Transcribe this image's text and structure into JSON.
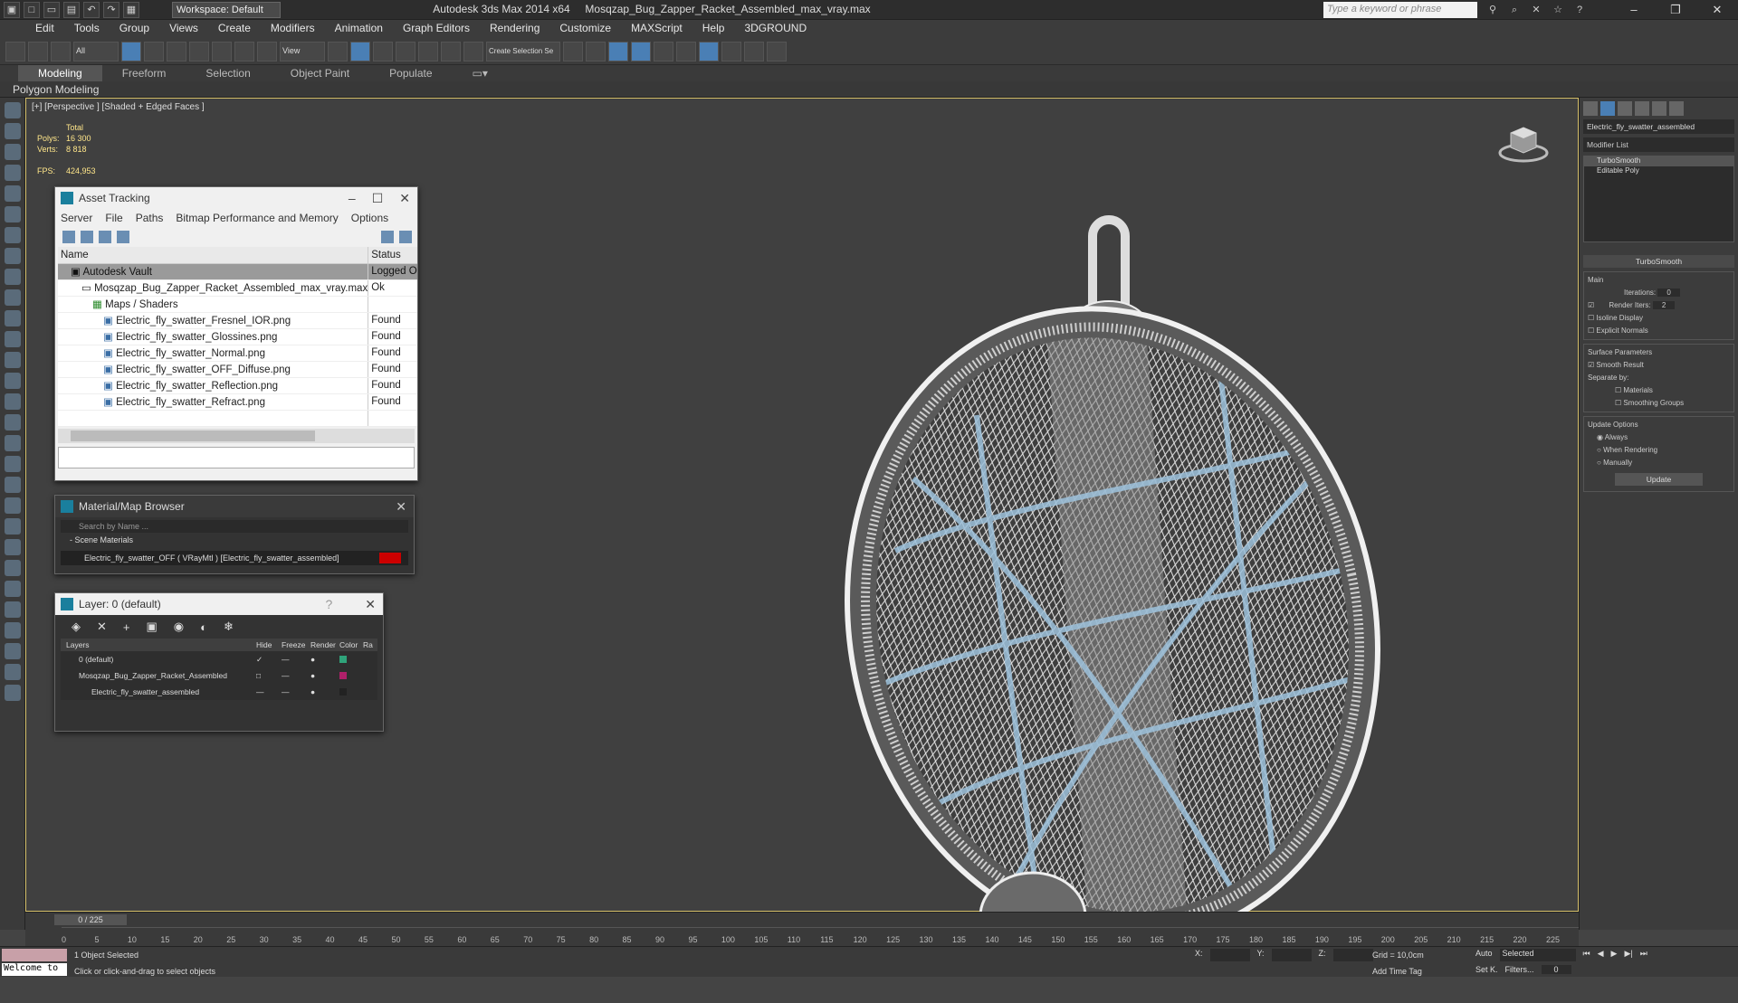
{
  "title_bar": {
    "workspace": "Workspace: Default",
    "app": "Autodesk 3ds Max  2014 x64",
    "file": "Mosqzap_Bug_Zapper_Racket_Assembled_max_vray.max",
    "search_placeholder": "Type a keyword or phrase"
  },
  "menu": [
    "Edit",
    "Tools",
    "Group",
    "Views",
    "Create",
    "Modifiers",
    "Animation",
    "Graph Editors",
    "Rendering",
    "Customize",
    "MAXScript",
    "Help",
    "3DGROUND"
  ],
  "main_toolbar": {
    "selection_filter": "All",
    "ref_coord": "View",
    "named_selection": "Create Selection Se"
  },
  "ribbon": {
    "tabs": [
      "Modeling",
      "Freeform",
      "Selection",
      "Object Paint",
      "Populate"
    ],
    "active": "Modeling",
    "sub": "Polygon Modeling"
  },
  "viewport": {
    "label": "[+] [Perspective ] [Shaded + Edged Faces ]",
    "stats_header": "Total",
    "polys_label": "Polys:",
    "polys": "16 300",
    "verts_label": "Verts:",
    "verts": "8 818",
    "fps_label": "FPS:",
    "fps": "424,953"
  },
  "asset_tracking": {
    "title": "Asset Tracking",
    "menu": [
      "Server",
      "File",
      "Paths",
      "Bitmap Performance and Memory",
      "Options"
    ],
    "col_name": "Name",
    "col_status": "Status",
    "rows": [
      {
        "name": "Autodesk Vault",
        "status": "Logged O",
        "indent": 1
      },
      {
        "name": "Mosqzap_Bug_Zapper_Racket_Assembled_max_vray.max",
        "status": "Ok",
        "indent": 2
      },
      {
        "name": "Maps / Shaders",
        "status": "",
        "indent": 3
      },
      {
        "name": "Electric_fly_swatter_Fresnel_IOR.png",
        "status": "Found",
        "indent": 4
      },
      {
        "name": "Electric_fly_swatter_Glossines.png",
        "status": "Found",
        "indent": 4
      },
      {
        "name": "Electric_fly_swatter_Normal.png",
        "status": "Found",
        "indent": 4
      },
      {
        "name": "Electric_fly_swatter_OFF_Diffuse.png",
        "status": "Found",
        "indent": 4
      },
      {
        "name": "Electric_fly_swatter_Reflection.png",
        "status": "Found",
        "indent": 4
      },
      {
        "name": "Electric_fly_swatter_Refract.png",
        "status": "Found",
        "indent": 4
      }
    ]
  },
  "material_browser": {
    "title": "Material/Map Browser",
    "search_placeholder": "Search by Name ...",
    "section": "- Scene Materials",
    "item": "Electric_fly_swatter_OFF ( VRayMtl ) [Electric_fly_swatter_assembled]"
  },
  "layer_dialog": {
    "title": "Layer: 0 (default)",
    "help": "?",
    "cols": [
      "Layers",
      "Hide",
      "Freeze",
      "Render",
      "Color",
      "Ra"
    ],
    "rows": [
      {
        "name": "0 (default)",
        "color": "#2fa37a"
      },
      {
        "name": "Mosqzap_Bug_Zapper_Racket_Assembled",
        "color": "#b0206a"
      },
      {
        "name": "Electric_fly_swatter_assembled",
        "color": "#222222"
      }
    ]
  },
  "command_panel": {
    "object_name": "Electric_fly_swatter_assembled",
    "modifier_list": "Modifier List",
    "stack": [
      "TurboSmooth",
      "Editable Poly"
    ],
    "rollout": "TurboSmooth",
    "main": "Main",
    "iterations_label": "Iterations:",
    "iterations": "0",
    "render_iters_label": "Render Iters:",
    "render_iters": "2",
    "isoline": "Isoline Display",
    "explicit": "Explicit Normals",
    "surface": "Surface Parameters",
    "smooth_result": "Smooth Result",
    "separate_by": "Separate by:",
    "materials": "Materials",
    "smoothing_groups": "Smoothing Groups",
    "update_options": "Update Options",
    "always": "Always",
    "when_rendering": "When Rendering",
    "manually": "Manually",
    "update_button": "Update"
  },
  "timeline": {
    "slider": "0 / 225",
    "ticks": [
      "0",
      "5",
      "10",
      "15",
      "20",
      "25",
      "30",
      "35",
      "40",
      "45",
      "50",
      "55",
      "60",
      "65",
      "70",
      "75",
      "80",
      "85",
      "90",
      "95",
      "100",
      "105",
      "110",
      "115",
      "120",
      "125",
      "130",
      "135",
      "140",
      "145",
      "150",
      "155",
      "160",
      "165",
      "170",
      "175",
      "180",
      "185",
      "190",
      "195",
      "200",
      "205",
      "210",
      "215",
      "220",
      "225"
    ]
  },
  "status": {
    "welcome": "Welcome to",
    "selected": "1 Object Selected",
    "prompt": "Click or click-and-drag to select objects",
    "x_label": "X:",
    "y_label": "Y:",
    "z_label": "Z:",
    "grid": "Grid = 10,0cm",
    "add_time_tag": "Add Time Tag",
    "auto": "Auto",
    "set_key": "Set K.",
    "key_mode": "Selected",
    "filters": "Filters...",
    "frame": "0"
  }
}
